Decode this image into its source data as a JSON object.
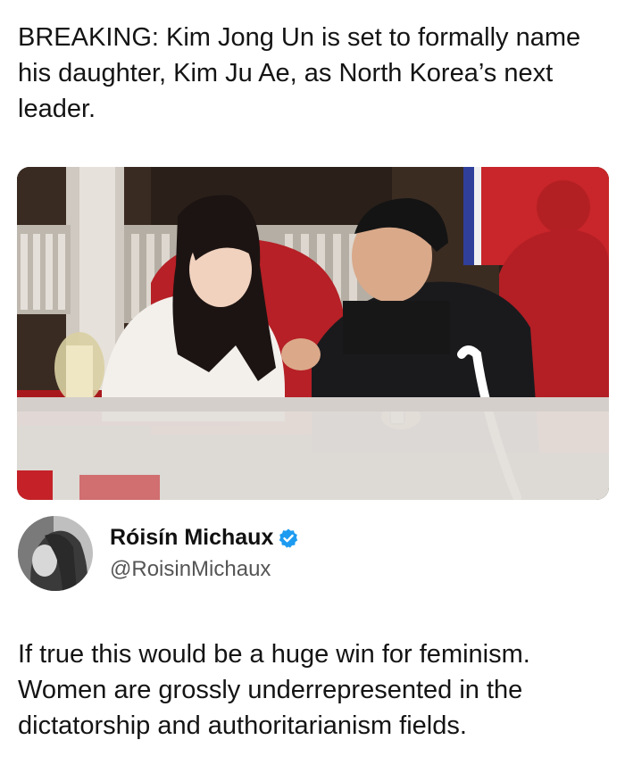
{
  "headline": "BREAKING: Kim Jong Un is set to formally name his daughter, Kim Ju Ae, as North Korea’s next leader.",
  "author": {
    "name": "Róisín Michaux",
    "handle": "@RoisinMichaux",
    "verified": true,
    "avatar_icon": "profile-photo"
  },
  "tweet": {
    "text": "If true this would be a huge win for feminism. Women are grossly underrepresented in the dictatorship and authoritarianism fields."
  },
  "colors": {
    "verified_blue": "#1d9bf0",
    "text_primary": "#141414",
    "text_secondary": "#555555"
  }
}
